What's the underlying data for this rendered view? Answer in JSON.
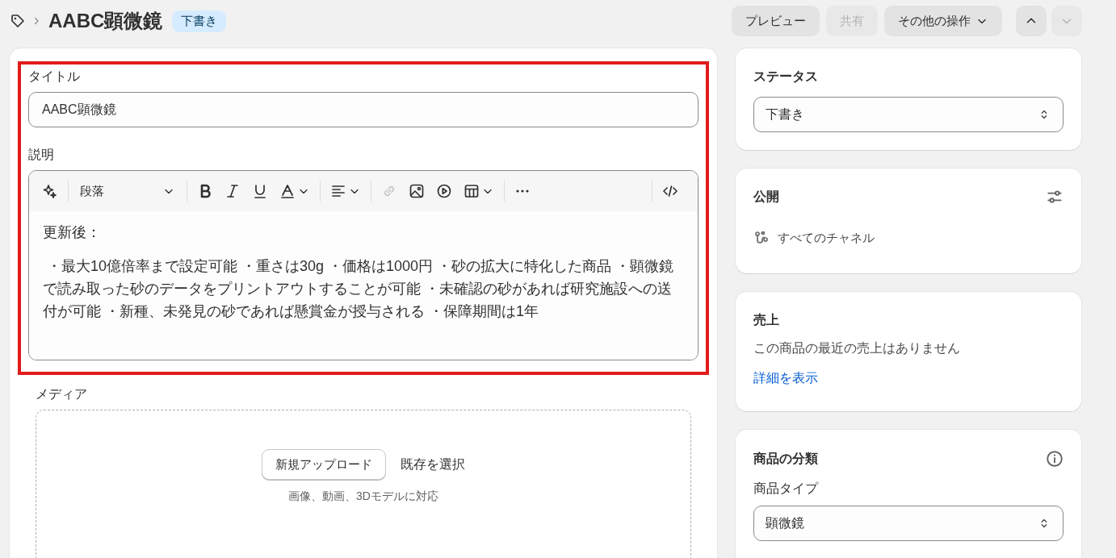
{
  "header": {
    "title": "AABC顕微鏡",
    "badge": "下書き",
    "buttons": [
      {
        "label": "プレビュー",
        "disabled": false,
        "menu": false
      },
      {
        "label": "共有",
        "disabled": true,
        "menu": false
      },
      {
        "label": "その他の操作",
        "disabled": false,
        "menu": true
      }
    ],
    "nav": [
      {
        "kind": "up",
        "disabled": false
      },
      {
        "kind": "down",
        "disabled": true
      }
    ]
  },
  "highlight": true,
  "title_field": {
    "label": "タイトル",
    "value": "AABC顕微鏡"
  },
  "description": {
    "label": "説明",
    "toolbar": {
      "groups": [
        [
          {
            "kind": "sparkle",
            "disabled": false,
            "menu": false
          }
        ],
        [
          {
            "kind": "style",
            "label": "段落",
            "disabled": false,
            "menu": true
          }
        ],
        [
          {
            "kind": "bold",
            "disabled": false,
            "menu": false
          },
          {
            "kind": "italic",
            "disabled": false,
            "menu": false
          },
          {
            "kind": "underline",
            "disabled": false,
            "menu": false
          },
          {
            "kind": "color",
            "disabled": false,
            "menu": true
          }
        ],
        [
          {
            "kind": "align",
            "disabled": false,
            "menu": true
          }
        ],
        [
          {
            "kind": "link",
            "disabled": true,
            "menu": false
          },
          {
            "kind": "image",
            "disabled": false,
            "menu": false
          },
          {
            "kind": "video",
            "disabled": false,
            "menu": false
          },
          {
            "kind": "table",
            "disabled": false,
            "menu": true
          }
        ],
        [
          {
            "kind": "more",
            "disabled": false,
            "menu": false
          }
        ]
      ],
      "end": [
        {
          "kind": "code",
          "disabled": false,
          "menu": false
        }
      ]
    },
    "paragraphs": [
      "更新後：",
      " ・最大10億倍率まで設定可能 ・重さは30g ・価格は1000円 ・砂の拡大に特化した商品 ・顕微鏡で読み取った砂のデータをプリントアウトすることが可能 ・未確認の砂があれば研究施設への送付が可能 ・新種、未発見の砂であれば懸賞金が授与される ・保障期間は1年"
    ]
  },
  "media": {
    "label": "メディア",
    "upload_button": "新規アップロード",
    "select_link": "既存を選択",
    "hint": "画像、動画、3Dモデルに対応"
  },
  "status": {
    "title": "ステータス",
    "value": "下書き"
  },
  "publishing": {
    "title": "公開",
    "channels": "すべてのチャネル"
  },
  "sales": {
    "title": "売上",
    "message": "この商品の最近の売上はありません",
    "link": "詳細を表示"
  },
  "category": {
    "title": "商品の分類",
    "type_label": "商品タイプ",
    "type_value": "顕微鏡"
  }
}
